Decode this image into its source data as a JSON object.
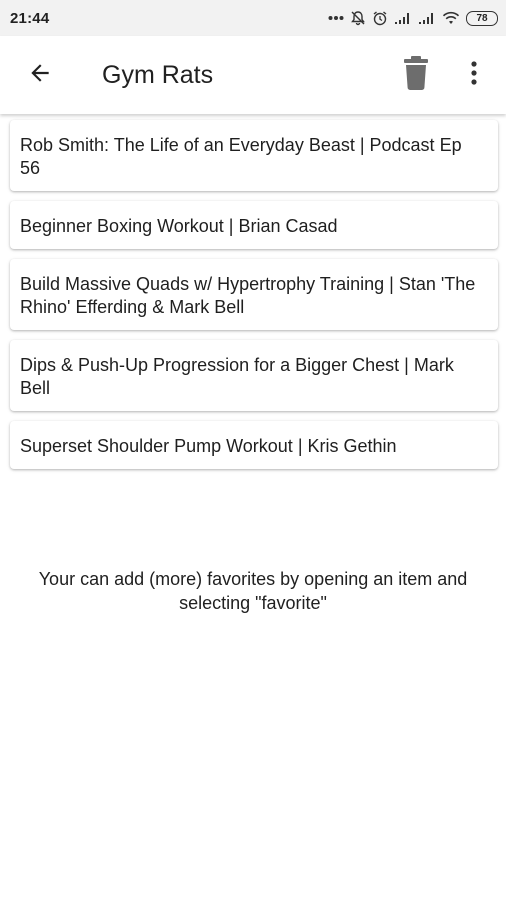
{
  "status_bar": {
    "time": "21:44",
    "battery": "78",
    "icons": [
      "more-dots-icon",
      "notifications-muted-icon",
      "alarm-icon",
      "signal-icon",
      "signal-icon",
      "wifi-icon",
      "battery-icon"
    ]
  },
  "app_bar": {
    "title": "Gym Rats",
    "back_icon": "arrow-left-icon",
    "delete_icon": "trash-icon",
    "menu_icon": "more-vert-icon"
  },
  "favorites": [
    {
      "title": "Rob Smith: The Life of an Everyday Beast | Podcast Ep 56"
    },
    {
      "title": "Beginner Boxing Workout | Brian Casad"
    },
    {
      "title": "Build Massive Quads w/ Hypertrophy Training | Stan 'The Rhino' Efferding & Mark Bell"
    },
    {
      "title": "Dips & Push-Up Progression for a Bigger Chest | Mark Bell"
    },
    {
      "title": "Superset Shoulder Pump Workout | Kris Gethin"
    }
  ],
  "hint": "Your can add (more) favorites by opening an item and selecting \"favorite\"",
  "colors": {
    "status_bar_bg": "#f2f2f2",
    "icon_gray": "#6d6d6d",
    "text": "#212121"
  }
}
